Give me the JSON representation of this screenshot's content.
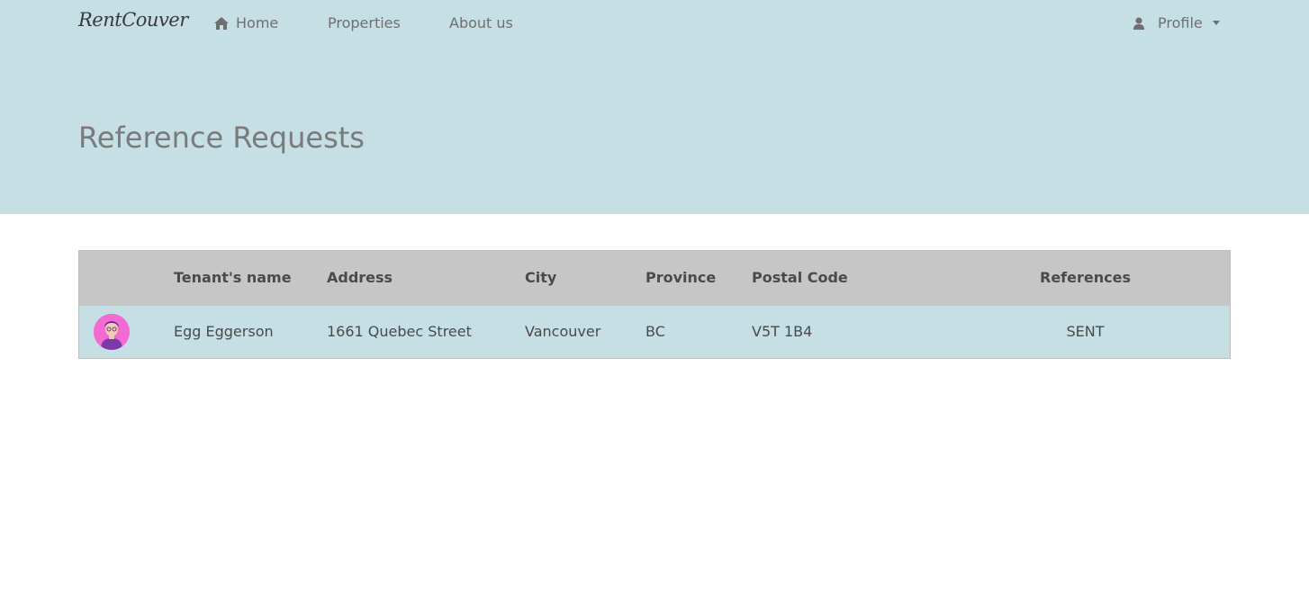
{
  "navbar": {
    "brand": "RentCouver",
    "home_label": "Home",
    "properties_label": "Properties",
    "about_label": "About us",
    "profile_label": "Profile"
  },
  "header": {
    "title": "Reference Requests"
  },
  "table": {
    "columns": [
      "",
      "Tenant's name",
      "Address",
      "City",
      "Province",
      "Postal Code",
      "References"
    ],
    "rows": [
      {
        "name": "Egg Eggerson",
        "address": "1661 Quebec Street",
        "city": "Vancouver",
        "province": "BC",
        "postal_code": "V5T 1B4",
        "references": "SENT"
      }
    ]
  }
}
